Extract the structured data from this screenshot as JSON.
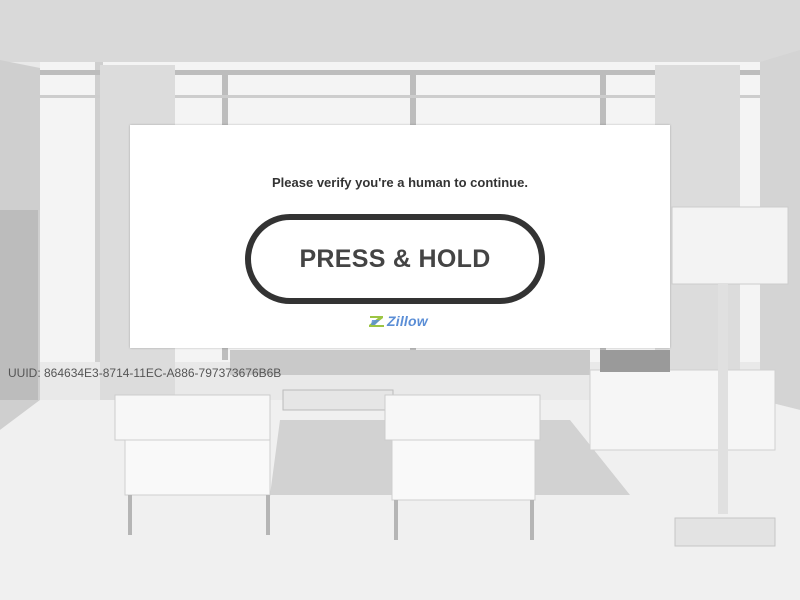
{
  "captcha": {
    "prompt": "Please verify you're a human to continue.",
    "button_label": "PRESS & HOLD",
    "logo_text": "Zillow",
    "logo_icon": "zillow-logo-icon"
  },
  "footer": {
    "uuid_text": "UUID: 864634E3-8714-11EC-A886-797373676B6B"
  },
  "colors": {
    "card_background": "#ffffff",
    "button_border": "#333333",
    "button_text": "#444444",
    "logo_blue": "#5b8ed6",
    "logo_green": "#9cc543"
  }
}
